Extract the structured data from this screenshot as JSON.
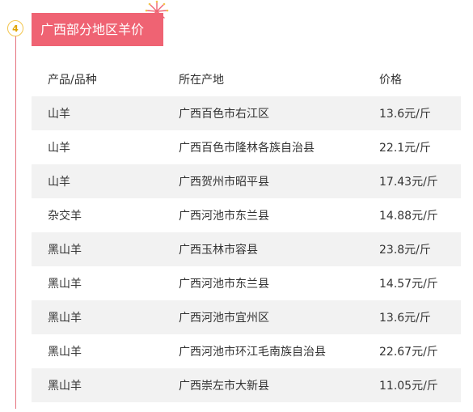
{
  "section": {
    "step_number": "4",
    "title": "广西部分地区羊价"
  },
  "table": {
    "headers": {
      "product": "产品/品种",
      "place": "所在产地",
      "price": "价格"
    },
    "rows": [
      {
        "product": "山羊",
        "place": "广西百色市右江区",
        "price": "13.6元/斤"
      },
      {
        "product": "山羊",
        "place": "广西百色市隆林各族自治县",
        "price": "22.1元/斤"
      },
      {
        "product": "山羊",
        "place": "广西贺州市昭平县",
        "price": "17.43元/斤"
      },
      {
        "product": "杂交羊",
        "place": "广西河池市东兰县",
        "price": "14.88元/斤"
      },
      {
        "product": "黑山羊",
        "place": "广西玉林市容县",
        "price": "23.8元/斤"
      },
      {
        "product": "黑山羊",
        "place": "广西河池市东兰县",
        "price": "14.57元/斤"
      },
      {
        "product": "黑山羊",
        "place": "广西河池市宜州区",
        "price": "13.6元/斤"
      },
      {
        "product": "黑山羊",
        "place": "广西河池市环江毛南族自治县",
        "price": "22.67元/斤"
      },
      {
        "product": "黑山羊",
        "place": "广西崇左市大新县",
        "price": "11.05元/斤"
      }
    ]
  },
  "colors": {
    "accent": "#ef6373",
    "badge": "#f3c54d",
    "row_stripe": "#f2f2f2"
  },
  "icons": {
    "decoration": "firework-icon"
  }
}
